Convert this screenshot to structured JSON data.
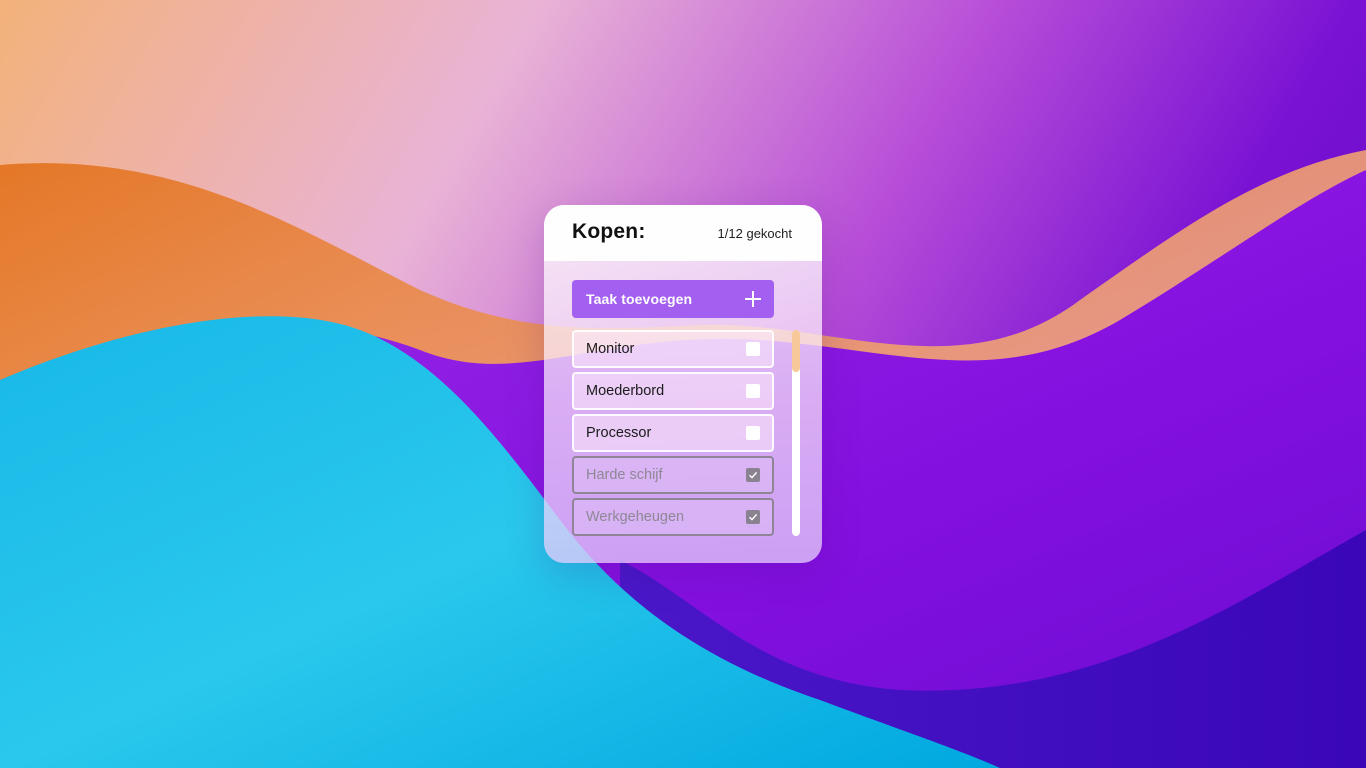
{
  "card": {
    "title": "Kopen:",
    "count": "1/12 gekocht",
    "add_button_label": "Taak toevoegen"
  },
  "items": [
    {
      "label": "Monitor",
      "checked": false
    },
    {
      "label": "Moederbord",
      "checked": false
    },
    {
      "label": "Processor",
      "checked": false
    },
    {
      "label": "Harde schijf",
      "checked": true
    },
    {
      "label": "Werkgeheugen",
      "checked": true
    }
  ],
  "icons": {
    "add": "plus-icon",
    "check": "checkmark-icon"
  },
  "colors": {
    "accent": "#a35ff0",
    "scroll_thumb": "#f7c99a",
    "done_border": "#8f8596"
  }
}
